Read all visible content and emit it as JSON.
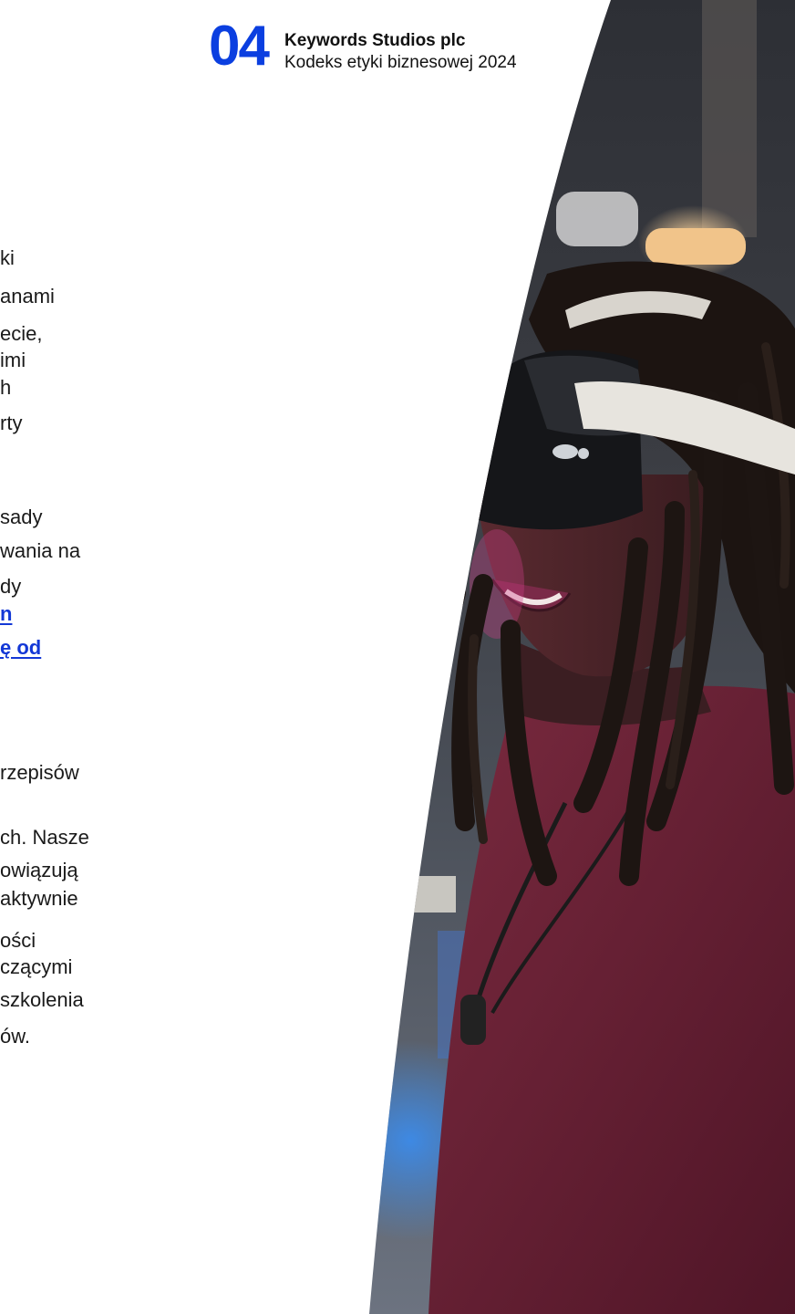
{
  "header": {
    "page_number": "04",
    "company": "Keywords Studios plc",
    "document_title": "Kodeks etyki biznesowej 2024"
  },
  "body_fragments": {
    "f1": "ki",
    "f2": "anami",
    "f3": "ecie,",
    "f4": "imi",
    "f5": "h",
    "f6": "rty",
    "f7": "sady",
    "f8": "wania na",
    "f9": "dy",
    "f10": "n",
    "f11": "ę od",
    "f12": "rzepisów",
    "f13": "ch. Nasze",
    "f14": "owiązują",
    "f15": "aktywnie",
    "f16": "ości",
    "f17": "czącymi",
    "f18": "szkolenia",
    "f19": "ów."
  },
  "colors": {
    "accent_blue": "#0b3fe0",
    "link_blue": "#1338d6",
    "shirt_maroon": "#6b1f35"
  },
  "image": {
    "description_icon": "vr-headset-person-photo"
  }
}
